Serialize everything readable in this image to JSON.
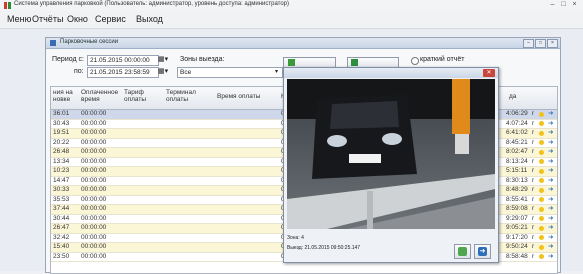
{
  "app": {
    "title": "Система управления парковкой (Пользователь: администратор, уровень доступа: администратор)"
  },
  "menu": [
    "Меню",
    "Отчёты",
    "Окно",
    "Сервис",
    "Выход"
  ],
  "window": {
    "title": "Парковочные сессии",
    "period_from_label": "Период с:",
    "period_from_value": "21.05.2015 00:00:00",
    "period_to_label": "по:",
    "period_to_value": "21.05.2015 23:58:59",
    "zones_label": "Зоны выезда:",
    "zones_value": "Все",
    "brief_report_label": "краткий отчёт"
  },
  "table": {
    "columns": [
      "ния на\nновке",
      "Оплаченное\nвремя",
      "Тариф\nоплаты",
      "Терминал\nоплаты",
      "Время оплаты",
      "Н",
      "да"
    ],
    "rows": [
      {
        "time": "36:01",
        "paid": "00:00:00",
        "n": "0",
        "end": "4:06:29",
        "ind": "r"
      },
      {
        "time": "30:43",
        "paid": "00:00:00",
        "n": "0",
        "end": "4:07:24",
        "ind": "r"
      },
      {
        "time": "19:51",
        "paid": "00:00:00",
        "n": "0",
        "end": "6:41:02",
        "ind": "r"
      },
      {
        "time": "20:22",
        "paid": "00:00:00",
        "n": "0",
        "end": "8:45:21",
        "ind": "r"
      },
      {
        "time": "26:48",
        "paid": "00:00:00",
        "n": "0",
        "end": "8:02:47",
        "ind": "r"
      },
      {
        "time": "13:34",
        "paid": "00:00:00",
        "n": "0",
        "end": "8:13:24",
        "ind": "r"
      },
      {
        "time": "10:23",
        "paid": "00:00:00",
        "n": "0",
        "end": "5:15:11",
        "ind": "r"
      },
      {
        "time": "14:47",
        "paid": "00:00:00",
        "n": "0",
        "end": "8:30:13",
        "ind": "r"
      },
      {
        "time": "30:33",
        "paid": "00:00:00",
        "n": "0",
        "end": "8:48:29",
        "ind": "r"
      },
      {
        "time": "35:53",
        "paid": "00:00:00",
        "n": "0",
        "end": "8:55:41",
        "ind": "r"
      },
      {
        "time": "37:44",
        "paid": "00:00:00",
        "n": "0",
        "end": "8:59:08",
        "ind": "r"
      },
      {
        "time": "30:44",
        "paid": "00:00:00",
        "n": "0",
        "end": "9:29:07",
        "ind": "r"
      },
      {
        "time": "26:47",
        "paid": "00:00:00",
        "n": "0",
        "end": "9:05:21",
        "ind": "r"
      },
      {
        "time": "32:42",
        "paid": "00:00:00",
        "n": "0",
        "end": "9:17:20",
        "ind": "r"
      },
      {
        "time": "15:40",
        "paid": "00:00:00",
        "n": "0",
        "end": "9:50:24",
        "ind": "r"
      },
      {
        "time": "23:50",
        "paid": "00:00:00",
        "n": "0",
        "end": "8:58:48",
        "ind": "r"
      }
    ]
  },
  "photo_popup": {
    "entry_label": "Зона: 4",
    "exit_label": "Выезд: 21.05.2015 09:50:25.147",
    "plate": "X 4"
  },
  "colors": {
    "row_highlight": "#fbf6d6",
    "row_selected": "#cfd8ea",
    "status_dot": "#f2c21b"
  }
}
